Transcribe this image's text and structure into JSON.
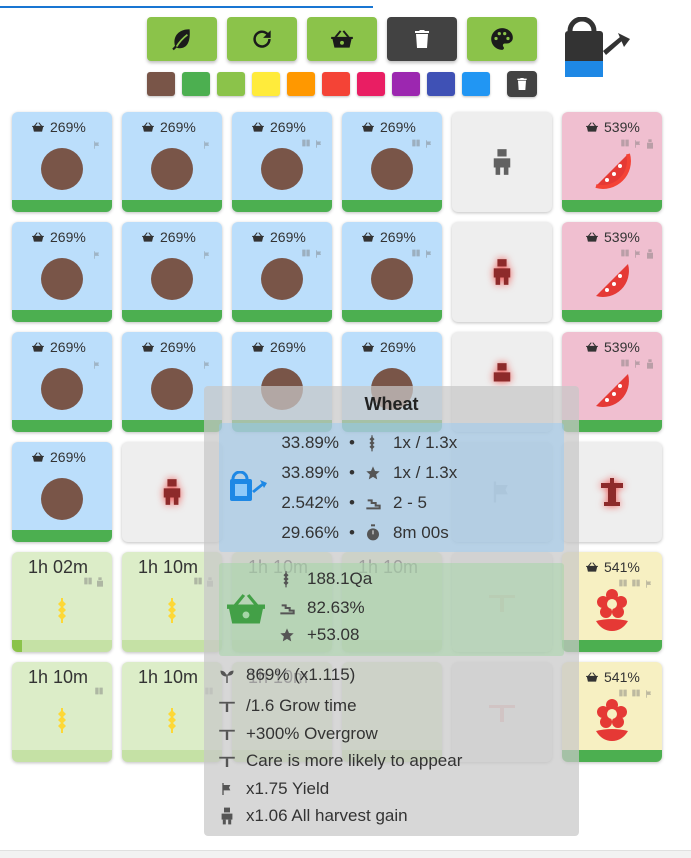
{
  "toolbar": {
    "buttons": [
      {
        "name": "seeds-button",
        "icon": "leaf-icon",
        "color": "#8bc34a"
      },
      {
        "name": "refresh-button",
        "icon": "refresh-icon",
        "color": "#8bc34a"
      },
      {
        "name": "harvest-button",
        "icon": "basket-icon",
        "color": "#8bc34a"
      },
      {
        "name": "trash-button",
        "icon": "trash-icon",
        "color": "#424242"
      },
      {
        "name": "palette-button",
        "icon": "palette-icon",
        "color": "#8bc34a"
      }
    ],
    "swatches": [
      "#795548",
      "#4caf50",
      "#8bc34a",
      "#ffeb3b",
      "#ff9800",
      "#f44336",
      "#e91e63",
      "#9c27b0",
      "#3f51b5",
      "#2196f3"
    ]
  },
  "grid": {
    "percent_269": "269%",
    "percent_539": "539%",
    "percent_541": "541%",
    "time_102": "1h 02m",
    "time_110": "1h 10m"
  },
  "tooltip": {
    "title": "Wheat",
    "care": [
      {
        "value": "33.89%",
        "sep": "•",
        "icon": "wheat-icon",
        "effect": "1x / 1.3x"
      },
      {
        "value": "33.89%",
        "sep": "•",
        "icon": "star-icon",
        "effect": "1x / 1.3x"
      },
      {
        "value": "2.542%",
        "sep": "•",
        "icon": "stairs-icon",
        "effect": "2 - 5"
      },
      {
        "value": "29.66%",
        "sep": "•",
        "icon": "timer-icon",
        "effect": "8m 00s"
      }
    ],
    "yield": [
      {
        "icon": "wheat-icon",
        "text": "188.1Qa"
      },
      {
        "icon": "stairs-icon",
        "text": "82.63%"
      },
      {
        "icon": "star-icon",
        "text": "+53.08"
      }
    ],
    "modifiers": [
      {
        "icon": "sprout-icon",
        "text": "869% (x1.115)"
      },
      {
        "icon": "sprinkler-icon",
        "text": "/1.6 Grow time"
      },
      {
        "icon": "sprinkler-icon",
        "text": "+300% Overgrow"
      },
      {
        "icon": "sprinkler-icon",
        "text": "Care is more likely to appear"
      },
      {
        "icon": "flag-icon",
        "text": "x1.75 Yield"
      },
      {
        "icon": "person-icon",
        "text": "x1.06 All harvest gain"
      }
    ]
  },
  "colors": {
    "button_green": "#8bc34a",
    "button_dark": "#424242",
    "plot_blue": "#bbdefb",
    "plot_pink": "#f0bfd0",
    "plot_green": "#dcedc8",
    "plot_yellow": "#f7f0c2",
    "plot_gray": "#eeeeee",
    "soil": "#795548",
    "progress": "#4caf50",
    "watermelon": "#f44336",
    "wheat": "#fdd835"
  }
}
